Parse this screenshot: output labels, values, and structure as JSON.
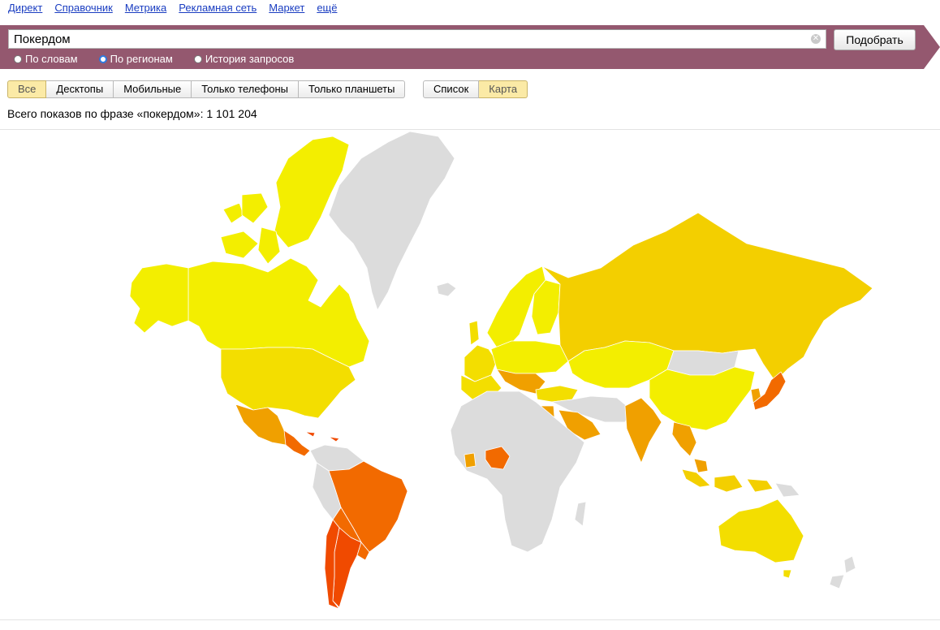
{
  "nav": [
    "Директ",
    "Справочник",
    "Метрика",
    "Рекламная сеть",
    "Маркет",
    "ещё"
  ],
  "search": {
    "value": "Покердом",
    "button": "Подобрать",
    "modes": [
      {
        "label": "По словам",
        "selected": false
      },
      {
        "label": "По регионам",
        "selected": true
      },
      {
        "label": "История запросов",
        "selected": false
      }
    ]
  },
  "device_tabs": [
    {
      "label": "Все",
      "selected": true
    },
    {
      "label": "Десктопы",
      "selected": false
    },
    {
      "label": "Мобильные",
      "selected": false
    },
    {
      "label": "Только телефоны",
      "selected": false
    },
    {
      "label": "Только планшеты",
      "selected": false
    }
  ],
  "view_tabs": [
    {
      "label": "Список",
      "selected": false
    },
    {
      "label": "Карта",
      "selected": true
    }
  ],
  "total": "Всего показов по фразе «покердом»: 1 101 204",
  "colors": {
    "band": "#94586f",
    "no_data": "#dcdcdc",
    "light_yellow": "#f3ee00",
    "yellow": "#f3de00",
    "dark_yellow": "#f3cf00",
    "orange": "#f0a000",
    "dark_orange": "#f26a00",
    "red": "#f04a00",
    "accent_link": "#1a3dc1"
  },
  "map": {
    "regions": [
      {
        "name": "Canada",
        "color": "light_yellow"
      },
      {
        "name": "Alaska",
        "color": "light_yellow"
      },
      {
        "name": "Arctic islands",
        "color": "light_yellow"
      },
      {
        "name": "USA",
        "color": "yellow"
      },
      {
        "name": "Greenland",
        "color": "no_data"
      },
      {
        "name": "Iceland",
        "color": "no_data"
      },
      {
        "name": "Mexico",
        "color": "orange"
      },
      {
        "name": "Central America",
        "color": "dark_orange"
      },
      {
        "name": "Caribbean",
        "color": "red"
      },
      {
        "name": "Northern South America",
        "color": "no_data"
      },
      {
        "name": "Brazil",
        "color": "dark_orange"
      },
      {
        "name": "Bolivia-Paraguay",
        "color": "dark_orange"
      },
      {
        "name": "Argentina",
        "color": "red"
      },
      {
        "name": "Chile",
        "color": "red"
      },
      {
        "name": "Uruguay",
        "color": "dark_orange"
      },
      {
        "name": "Peru",
        "color": "no_data"
      },
      {
        "name": "Scandinavia",
        "color": "light_yellow"
      },
      {
        "name": "Finland",
        "color": "light_yellow"
      },
      {
        "name": "Western Europe",
        "color": "yellow"
      },
      {
        "name": "Central Europe",
        "color": "light_yellow"
      },
      {
        "name": "Balkans",
        "color": "orange"
      },
      {
        "name": "Russia",
        "color": "dark_yellow"
      },
      {
        "name": "Kazakhstan & Central Asia",
        "color": "light_yellow"
      },
      {
        "name": "Mongolia",
        "color": "no_data"
      },
      {
        "name": "China",
        "color": "light_yellow"
      },
      {
        "name": "Korea",
        "color": "orange"
      },
      {
        "name": "Japan",
        "color": "dark_orange"
      },
      {
        "name": "Turkey",
        "color": "yellow"
      },
      {
        "name": "Middle East",
        "color": "no_data"
      },
      {
        "name": "Saudi Arabia",
        "color": "orange"
      },
      {
        "name": "Egypt",
        "color": "orange"
      },
      {
        "name": "India",
        "color": "orange"
      },
      {
        "name": "Southeast Asia",
        "color": "orange"
      },
      {
        "name": "Indonesia",
        "color": "dark_yellow"
      },
      {
        "name": "Africa",
        "color": "no_data"
      },
      {
        "name": "Nigeria",
        "color": "dark_orange"
      },
      {
        "name": "Ghana",
        "color": "orange"
      },
      {
        "name": "Madagascar",
        "color": "no_data"
      },
      {
        "name": "Australia",
        "color": "yellow"
      },
      {
        "name": "New Zealand",
        "color": "no_data"
      },
      {
        "name": "Papua New Guinea",
        "color": "no_data"
      }
    ]
  }
}
